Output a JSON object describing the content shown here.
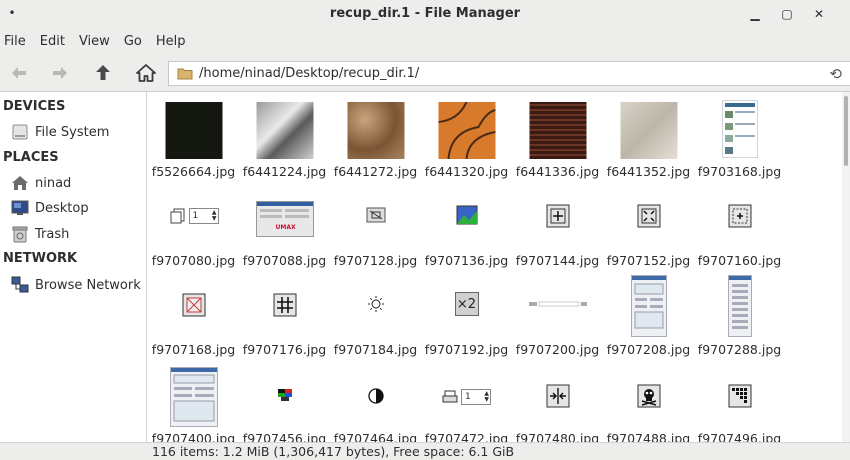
{
  "window": {
    "title": "recup_dir.1 - File Manager",
    "menu_glyph": "•",
    "minimize_glyph": "▁",
    "maximize_glyph": "▢",
    "close_glyph": "✕"
  },
  "menubar": [
    "File",
    "Edit",
    "View",
    "Go",
    "Help"
  ],
  "toolbar": {
    "path": "/home/ninad/Desktop/recup_dir.1/",
    "icons": [
      "back-arrow-icon",
      "forward-arrow-icon",
      "up-arrow-icon",
      "home-icon",
      "folder-icon",
      "reload-icon"
    ]
  },
  "sidebar": {
    "devices_label": "DEVICES",
    "places_label": "PLACES",
    "network_label": "NETWORK",
    "file_system": "File System",
    "ninad": "ninad",
    "desktop": "Desktop",
    "trash": "Trash",
    "browse_network": "Browse Network"
  },
  "files": [
    "f5526664.jpg",
    "f6441224.jpg",
    "f6441272.jpg",
    "f6441320.jpg",
    "f6441336.jpg",
    "f6441352.jpg",
    "f9703168.jpg",
    "f9707080.jpg",
    "f9707088.jpg",
    "f9707128.jpg",
    "f9707136.jpg",
    "f9707144.jpg",
    "f9707152.jpg",
    "f9707160.jpg",
    "f9707168.jpg",
    "f9707176.jpg",
    "f9707184.jpg",
    "f9707192.jpg",
    "f9707200.jpg",
    "f9707208.jpg",
    "f9707288.jpg",
    "f9707400.jpg",
    "f9707456.jpg",
    "f9707464.jpg",
    "f9707472.jpg",
    "f9707480.jpg",
    "f9707488.jpg",
    "f9707496.jpg"
  ],
  "thumb_text": {
    "spin1": "1",
    "spin2": "1",
    "umax": "UMAX",
    "x2": "×2"
  },
  "status": "116 items: 1.2 MiB (1,306,417 bytes), Free space: 6.1 GiB"
}
